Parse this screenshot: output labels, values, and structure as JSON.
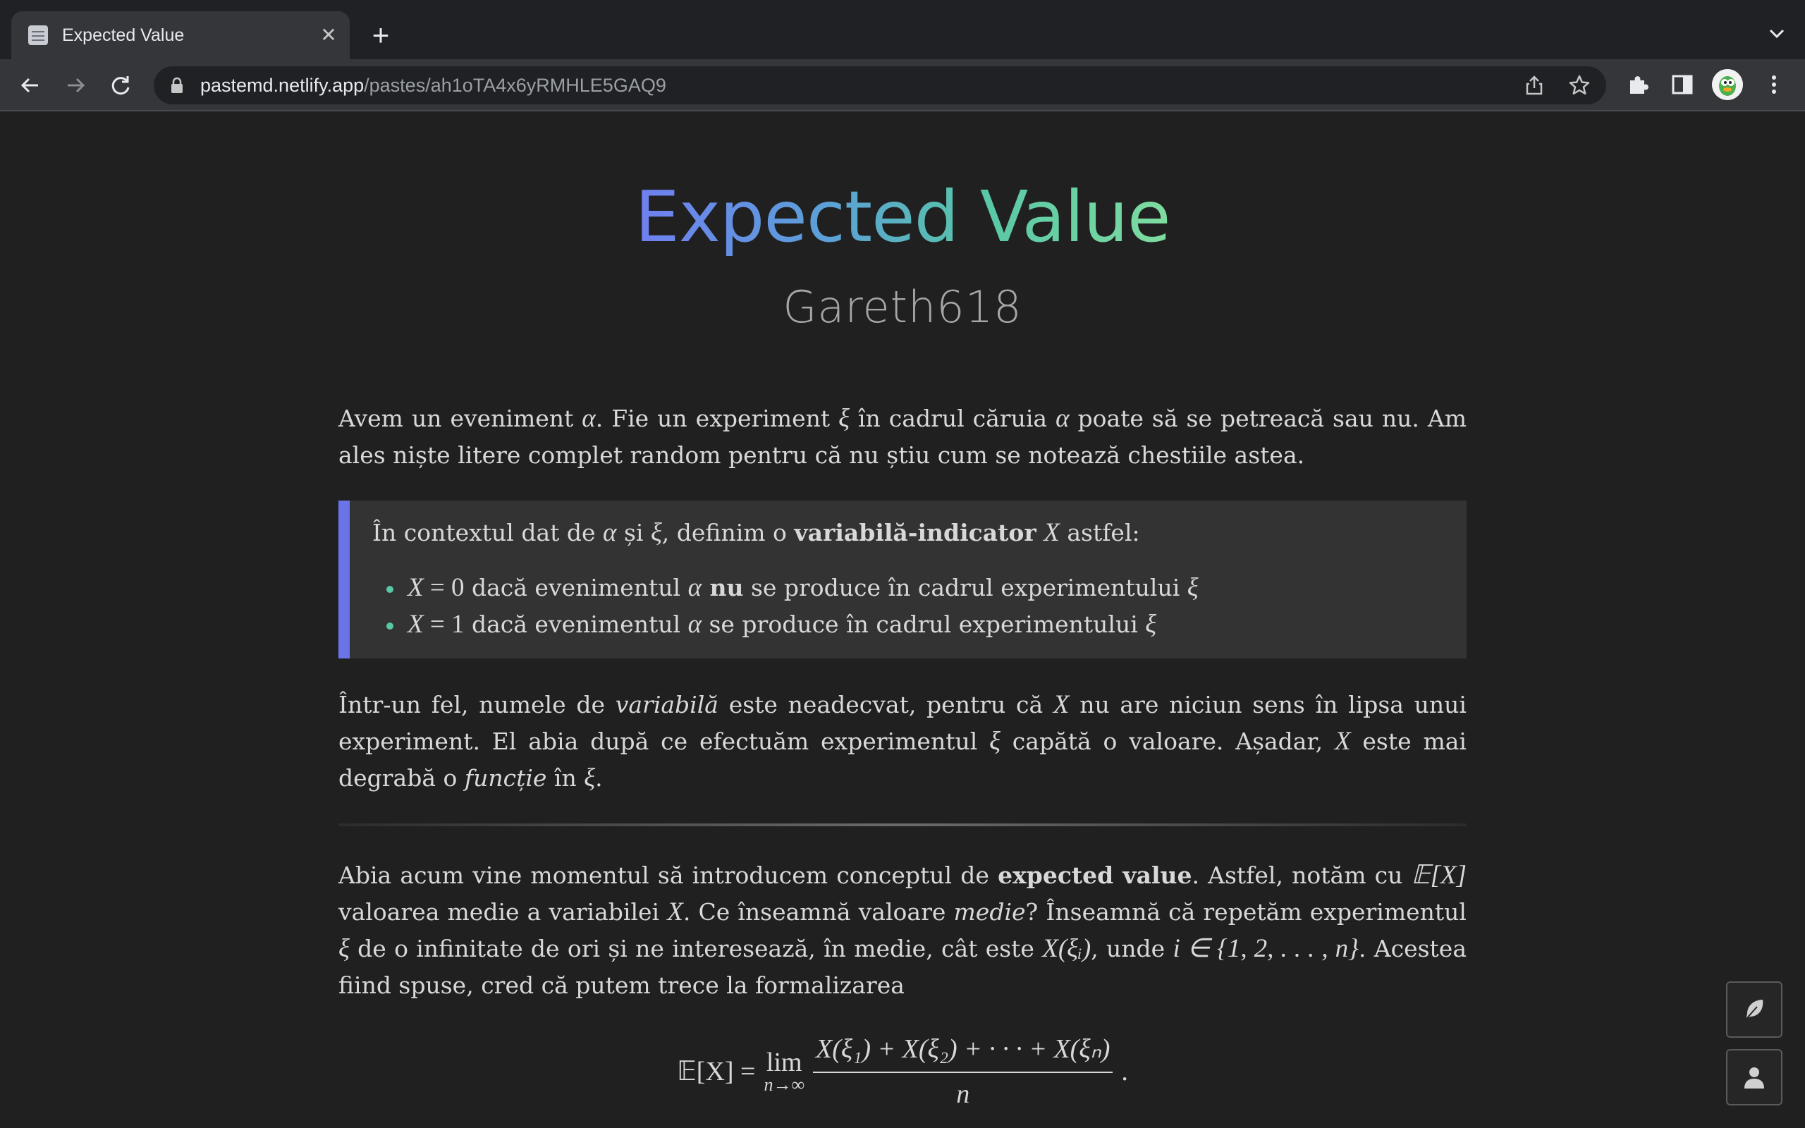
{
  "browser": {
    "tab_title": "Expected Value",
    "tab_close": "✕",
    "new_tab": "+",
    "url_host": "pastemd.netlify.app",
    "url_path": "/pastes/ah1oTA4x6yRMHLE5GAQ9"
  },
  "doc": {
    "title": "Expected Value",
    "author": "Gareth618"
  },
  "p1": {
    "a": "Avem un eveniment ",
    "alpha": "α",
    "b": ". Fie un experiment ",
    "xi": "ξ",
    "c": " în cadrul căruia ",
    "alpha2": "α",
    "d": " poate să se petreacă sau nu. Am ales niște litere complet random pentru că nu știu cum se notează chestiile astea."
  },
  "callout": {
    "a": "În contextul dat de ",
    "alpha": "α",
    "b": " și ",
    "xi": "ξ",
    "c": ", definim o ",
    "bold": "variabilă-indicator",
    "X": "X",
    "d": " astfel:",
    "items": [
      {
        "X": "X",
        "eq": " = 0",
        "a": " dacă evenimentul ",
        "alpha": "α",
        "bold": " nu",
        "b": " se produce în cadrul experimentului ",
        "xi": "ξ"
      },
      {
        "X": "X",
        "eq": " = 1",
        "a": " dacă evenimentul ",
        "alpha": "α",
        "b": " se produce în cadrul experimentului ",
        "xi": "ξ"
      }
    ]
  },
  "p2": {
    "a": "Într-un fel, numele de ",
    "em1": "variabilă",
    "b": " este neadecvat, pentru că ",
    "X": "X",
    "c": " nu are niciun sens în lipsa unui experiment. El abia după ce efectuăm experimentul ",
    "xi": "ξ",
    "d": " capătă o valoare. Așadar, ",
    "X2": "X",
    "e": " este mai degrabă o ",
    "em2": "funcție",
    "f": " în ",
    "xi2": "ξ",
    "g": "."
  },
  "p3": {
    "a": "Abia acum vine momentul să introducem conceptul de ",
    "bold": "expected value",
    "b": ". Astfel, notăm cu ",
    "EX": "𝔼[X]",
    "c": " valoarea medie a variabilei ",
    "X": "X",
    "d": ". Ce înseamnă valoare ",
    "em": "medie",
    "e": "? Înseamnă că repetăm experimentul ",
    "xi": "ξ",
    "f": " de o infinitate de ori și ne interesează, în medie, cât este ",
    "Xxi": "X(ξᵢ)",
    "g": ", unde ",
    "iset": "i ∈ {1, 2, . . . , n}",
    "h": ". Acestea fiind spuse, cred că putem trece la formalizarea"
  },
  "formula": {
    "lhs": "𝔼[X] =",
    "lim": "lim",
    "lim_sub": "n→∞",
    "numerator": "X(ξ₁) + X(ξ₂) + · · · + X(ξₙ)",
    "denominator": "n",
    "end": "."
  },
  "colors": {
    "accent_bar": "#6a73e8",
    "bullet": "#58c7a6",
    "title_gradient_start": "#6f7ff0",
    "title_gradient_end": "#7fdca0"
  },
  "icons": [
    "document-icon",
    "close-icon",
    "plus-icon",
    "chevron-down-icon",
    "back-arrow-icon",
    "forward-arrow-icon",
    "reload-icon",
    "lock-icon",
    "share-icon",
    "star-icon",
    "extensions-icon",
    "side-panel-icon",
    "profile-avatar",
    "more-vertical-icon",
    "feather-icon",
    "user-icon"
  ]
}
